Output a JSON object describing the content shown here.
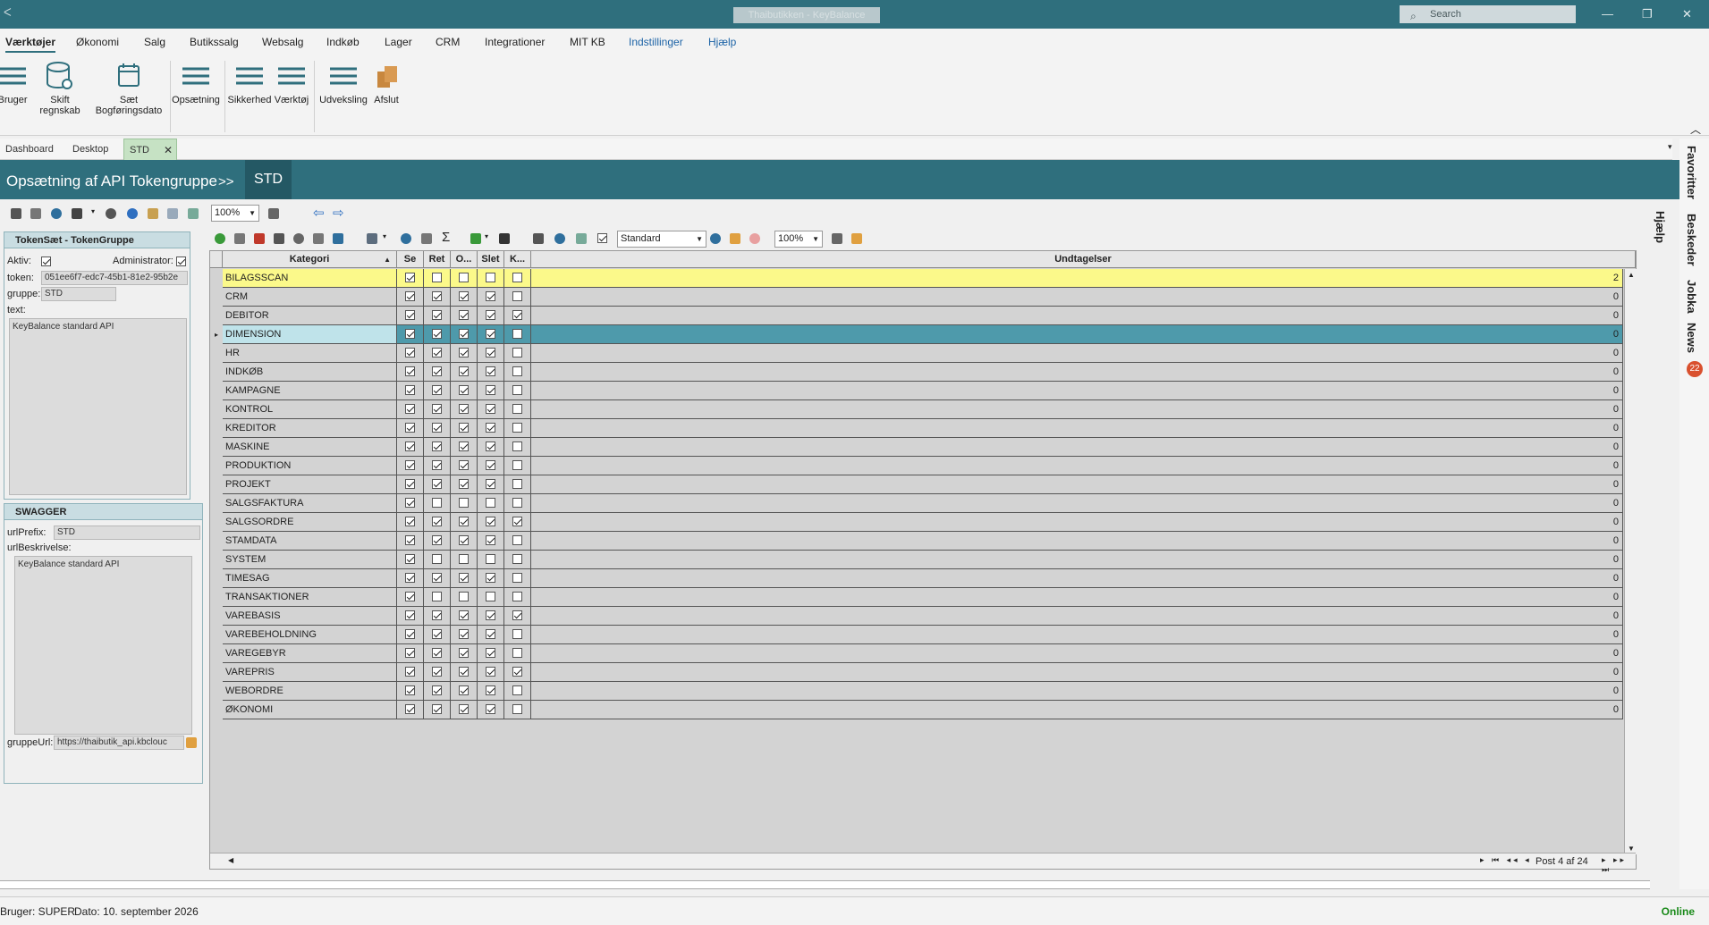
{
  "window": {
    "title": "Thaibutikken - KeyBalance",
    "search_placeholder": "Search",
    "minimize": "—",
    "maximize": "❐",
    "close": "✕"
  },
  "menu": {
    "items": [
      "Værktøjer",
      "Økonomi",
      "Salg",
      "Butikssalg",
      "Websalg",
      "Indkøb",
      "Lager",
      "CRM",
      "Integrationer",
      "MIT KB",
      "Indstillinger",
      "Hjælp"
    ]
  },
  "ribbon": {
    "bruger": "Bruger",
    "skift_regnskab_1": "Skift",
    "skift_regnskab_2": "regnskab",
    "saet_dato_1": "Sæt",
    "saet_dato_2": "Bogføringsdato",
    "opsaetning": "Opsætning",
    "sikkerhed": "Sikkerhed",
    "vaerktoj": "Værktøj",
    "udveksling": "Udveksling",
    "afslut": "Afslut"
  },
  "tabs": [
    "Dashboard",
    "Desktop",
    "STD"
  ],
  "header": {
    "title": "Opsætning af API Tokengruppe",
    "arrows": ">>",
    "crumb": "STD"
  },
  "right_sidebar": {
    "favoritter": "Favoritter",
    "beskeder": "Beskeder",
    "jobka": "Jobka",
    "news": "News",
    "news_count": "22",
    "hjaelp": "Hjælp"
  },
  "toolbar1": {
    "zoom": "100%"
  },
  "tokenset": {
    "title": "TokenSæt - TokenGruppe",
    "aktiv_label": "Aktiv:",
    "aktiv": true,
    "administrator_label": "Administrator:",
    "administrator": true,
    "token_label": "token:",
    "token": "051ee6f7-edc7-45b1-81e2-95b2e",
    "gruppe_label": "gruppe:",
    "gruppe": "STD",
    "text_label": "text:",
    "text": "KeyBalance standard API"
  },
  "swagger": {
    "title": "SWAGGER",
    "urlprefix_label": "urlPrefix:",
    "urlprefix": "STD",
    "urlbeskrivelse_label": "urlBeskrivelse:",
    "urlbeskrivelse": "KeyBalance standard API",
    "gruppeurl_label": "gruppeUrl:",
    "gruppeurl": "https://thaibutik_api.kbclouc"
  },
  "toolbar2": {
    "layout": "Standard",
    "zoom": "100%"
  },
  "grid": {
    "columns": [
      "Kategori",
      "Se",
      "Ret",
      "O...",
      "Slet",
      "K...",
      "Undtagelser"
    ],
    "rows": [
      {
        "k": "BILAGSSCAN",
        "se": true,
        "ret": false,
        "o": false,
        "slet": false,
        "kk": false,
        "u": "2"
      },
      {
        "k": "CRM",
        "se": true,
        "ret": true,
        "o": true,
        "slet": true,
        "kk": false,
        "u": "0"
      },
      {
        "k": "DEBITOR",
        "se": true,
        "ret": true,
        "o": true,
        "slet": true,
        "kk": true,
        "u": "0"
      },
      {
        "k": "DIMENSION",
        "se": true,
        "ret": true,
        "o": true,
        "slet": true,
        "kk": false,
        "u": "0"
      },
      {
        "k": "HR",
        "se": true,
        "ret": true,
        "o": true,
        "slet": true,
        "kk": false,
        "u": "0"
      },
      {
        "k": "INDKØB",
        "se": true,
        "ret": true,
        "o": true,
        "slet": true,
        "kk": false,
        "u": "0"
      },
      {
        "k": "KAMPAGNE",
        "se": true,
        "ret": true,
        "o": true,
        "slet": true,
        "kk": false,
        "u": "0"
      },
      {
        "k": "KONTROL",
        "se": true,
        "ret": true,
        "o": true,
        "slet": true,
        "kk": false,
        "u": "0"
      },
      {
        "k": "KREDITOR",
        "se": true,
        "ret": true,
        "o": true,
        "slet": true,
        "kk": false,
        "u": "0"
      },
      {
        "k": "MASKINE",
        "se": true,
        "ret": true,
        "o": true,
        "slet": true,
        "kk": false,
        "u": "0"
      },
      {
        "k": "PRODUKTION",
        "se": true,
        "ret": true,
        "o": true,
        "slet": true,
        "kk": false,
        "u": "0"
      },
      {
        "k": "PROJEKT",
        "se": true,
        "ret": true,
        "o": true,
        "slet": true,
        "kk": false,
        "u": "0"
      },
      {
        "k": "SALGSFAKTURA",
        "se": true,
        "ret": false,
        "o": false,
        "slet": false,
        "kk": false,
        "u": "0"
      },
      {
        "k": "SALGSORDRE",
        "se": true,
        "ret": true,
        "o": true,
        "slet": true,
        "kk": true,
        "u": "0"
      },
      {
        "k": "STAMDATA",
        "se": true,
        "ret": true,
        "o": true,
        "slet": true,
        "kk": false,
        "u": "0"
      },
      {
        "k": "SYSTEM",
        "se": true,
        "ret": false,
        "o": false,
        "slet": false,
        "kk": false,
        "u": "0"
      },
      {
        "k": "TIMESAG",
        "se": true,
        "ret": true,
        "o": true,
        "slet": true,
        "kk": false,
        "u": "0"
      },
      {
        "k": "TRANSAKTIONER",
        "se": true,
        "ret": false,
        "o": false,
        "slet": false,
        "kk": false,
        "u": "0"
      },
      {
        "k": "VAREBASIS",
        "se": true,
        "ret": true,
        "o": true,
        "slet": true,
        "kk": true,
        "u": "0"
      },
      {
        "k": "VAREBEHOLDNING",
        "se": true,
        "ret": true,
        "o": true,
        "slet": true,
        "kk": false,
        "u": "0"
      },
      {
        "k": "VAREGEBYR",
        "se": true,
        "ret": true,
        "o": true,
        "slet": true,
        "kk": false,
        "u": "0"
      },
      {
        "k": "VAREPRIS",
        "se": true,
        "ret": true,
        "o": true,
        "slet": true,
        "kk": true,
        "u": "0"
      },
      {
        "k": "WEBORDRE",
        "se": true,
        "ret": true,
        "o": true,
        "slet": true,
        "kk": false,
        "u": "0"
      },
      {
        "k": "ØKONOMI",
        "se": true,
        "ret": true,
        "o": true,
        "slet": true,
        "kk": false,
        "u": "0"
      }
    ],
    "selected_index": 3,
    "highlight_index": 0,
    "pager": "Post 4 af 24"
  },
  "status": {
    "bruger": "Bruger:  SUPER",
    "dato": "Dato:  10. september 2026",
    "online": "Online"
  },
  "colors": {
    "brand": "#2f6f7d",
    "selected_row": "#4e9aab",
    "highlight_row": "#fbf98a",
    "grid_bg": "#d3d3d3",
    "online": "#1a8a1a"
  }
}
